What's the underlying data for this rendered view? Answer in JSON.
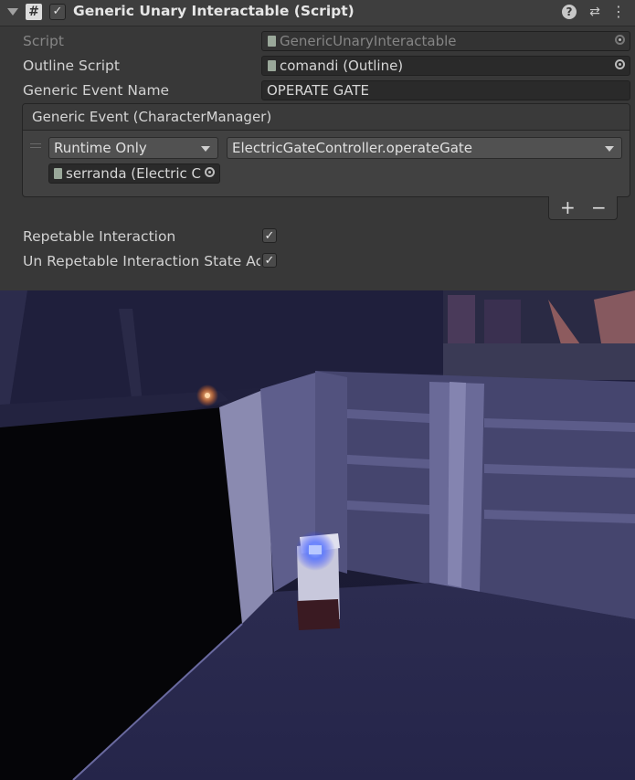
{
  "component": {
    "title": "Generic Unary Interactable (Script)",
    "enabled": true,
    "icons": [
      "foldout-arrow-icon",
      "script-hash-icon",
      "help-icon",
      "preset-sliders-icon",
      "kebab-menu-icon"
    ]
  },
  "fields": {
    "script": {
      "label": "Script",
      "value": "GenericUnaryInteractable"
    },
    "outline_script": {
      "label": "Outline Script",
      "value": "comandi (Outline)"
    },
    "generic_event_name": {
      "label": "Generic Event Name",
      "value": "OPERATE GATE"
    }
  },
  "event": {
    "title": "Generic Event (CharacterManager)",
    "call_state": "Runtime Only",
    "function": "ElectricGateController.operateGate",
    "target": "serranda (Electric C",
    "add_label": "+",
    "remove_label": "−"
  },
  "toggles": {
    "repeatable": {
      "label": "Repetable Interaction",
      "checked": true
    },
    "unrepeatable_state": {
      "label": "Un Repetable Interaction State Act",
      "checked": true
    }
  },
  "glyphs": {
    "check": "✓",
    "hash": "#",
    "help": "?",
    "sliders": "⇄",
    "menu": "⋮"
  },
  "colors": {
    "panel": "#383838",
    "field": "#2a2a2a",
    "scene_sky": "#1e1e3a",
    "gate": "#3c3c62",
    "ground": "#29294a",
    "button_glow": "#5a7cff",
    "lamp": "#ff9a4a"
  }
}
